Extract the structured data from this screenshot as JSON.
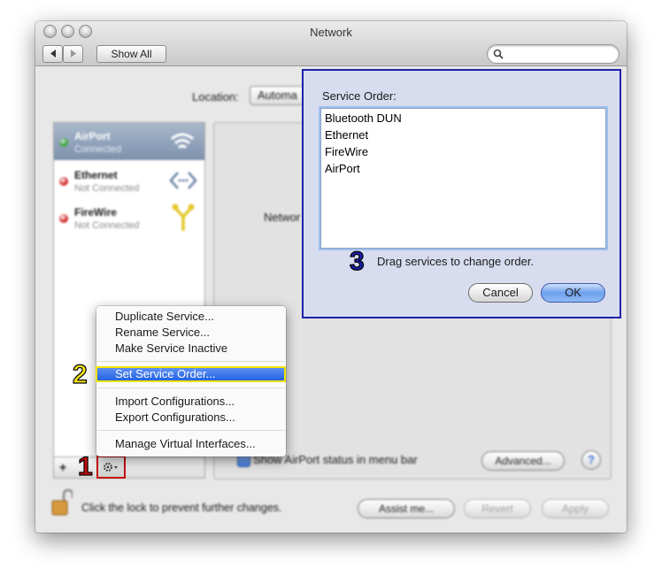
{
  "window": {
    "title": "Network"
  },
  "toolbar": {
    "back_icon": "chevron-left-icon",
    "forward_icon": "chevron-right-icon",
    "show_all_label": "Show All",
    "search_icon": "magnifier-icon"
  },
  "location": {
    "label": "Location:",
    "value": "Automa"
  },
  "services": [
    {
      "name": "AirPort",
      "status": "Connected",
      "status_color": "#3aa53a",
      "icon": "wifi-icon"
    },
    {
      "name": "Ethernet",
      "status": "Not Connected",
      "status_color": "#d22b2b",
      "icon": "ethernet-arrows-icon"
    },
    {
      "name": "FireWire",
      "status": "Not Connected",
      "status_color": "#d22b2b",
      "icon": "firewire-icon"
    }
  ],
  "detail": {
    "network_label_partial": "Networ",
    "show_status_checkbox": "Show AirPort status in menu bar",
    "advanced_label": "Advanced...",
    "help_label": "?"
  },
  "list_controls": {
    "add_label": "+",
    "action_icon": "gear-icon"
  },
  "action_menu": {
    "items": [
      "Duplicate Service...",
      "Rename Service...",
      "Make Service Inactive"
    ],
    "selected": "Set Service Order...",
    "items2": [
      "Import Configurations...",
      "Export Configurations..."
    ],
    "items3": [
      "Manage Virtual Interfaces..."
    ]
  },
  "sheet": {
    "label": "Service Order:",
    "order": [
      "Bluetooth DUN",
      "Ethernet",
      "FireWire",
      "AirPort"
    ],
    "hint": "Drag services to change order.",
    "cancel_label": "Cancel",
    "ok_label": "OK"
  },
  "footer": {
    "lock_icon": "unlocked-padlock-icon",
    "lock_text": "Click the lock to prevent further changes.",
    "assist_label": "Assist me...",
    "revert_label": "Revert",
    "apply_label": "Apply"
  },
  "steps": {
    "step1": "1",
    "step2": "2",
    "step3": "3",
    "step1_color": "#c41010",
    "step2_color": "#f3e21a",
    "step3_color": "#1c1fa6"
  }
}
